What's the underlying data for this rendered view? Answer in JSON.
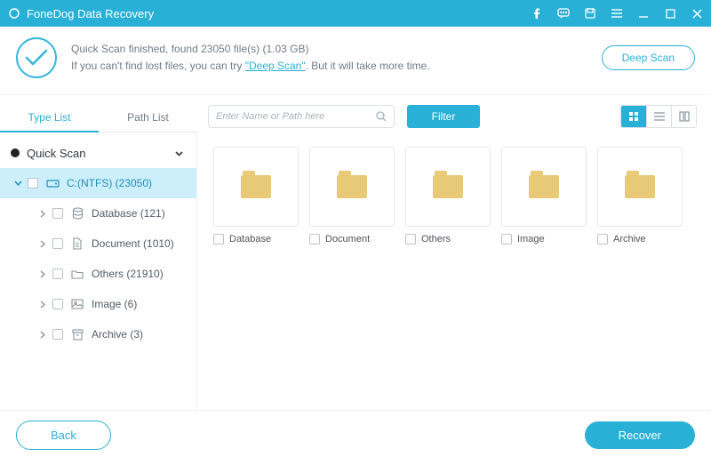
{
  "titlebar": {
    "app_name": "FoneDog Data Recovery"
  },
  "status": {
    "line1_prefix": "Quick Scan finished, found ",
    "file_count": "23050",
    "line1_mid": " file(s) (",
    "size": "1.03 GB",
    "line1_suffix": ")",
    "line2_prefix": "If you can't find lost files, you can try ",
    "deep_link": "\"Deep Scan\"",
    "line2_suffix": ". But it will take more time.",
    "deep_scan_btn": "Deep Scan"
  },
  "tabs": {
    "type": "Type List",
    "path": "Path List"
  },
  "search": {
    "placeholder": "Enter Name or Path here"
  },
  "filter_btn": "Filter",
  "sidebar": {
    "root": "Quick Scan",
    "drive": "C:(NTFS) (23050)",
    "items": [
      {
        "label": "Database (121)"
      },
      {
        "label": "Document (1010)"
      },
      {
        "label": "Others (21910)"
      },
      {
        "label": "Image (6)"
      },
      {
        "label": "Archive (3)"
      }
    ]
  },
  "folders": [
    {
      "label": "Database"
    },
    {
      "label": "Document"
    },
    {
      "label": "Others"
    },
    {
      "label": "Image"
    },
    {
      "label": "Archive"
    }
  ],
  "footer": {
    "back": "Back",
    "recover": "Recover"
  }
}
